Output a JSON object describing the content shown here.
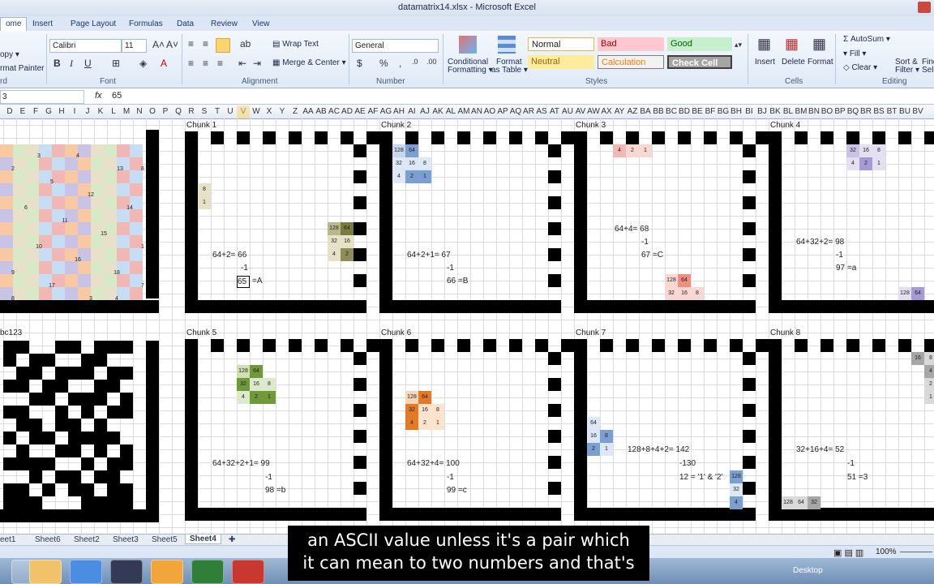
{
  "window": {
    "title": "datamatrix14.xlsx  -  Microsoft Excel"
  },
  "ribbon_tabs": [
    "ome",
    "Insert",
    "Page Layout",
    "Formulas",
    "Data",
    "Review",
    "View"
  ],
  "clipboard": {
    "copy": "opy ▾",
    "format_painter": "rmat Painter",
    "label": "rd"
  },
  "font": {
    "name": "Calibri",
    "size": "11",
    "label": "Font"
  },
  "alignment": {
    "wrap": "Wrap Text",
    "merge": "Merge & Center ▾",
    "label": "Alignment"
  },
  "number": {
    "format": "General",
    "label": "Number"
  },
  "styles": {
    "cond": "Conditional",
    "cond2": "Formatting ▾",
    "fmt": "Format",
    "fmt2": "as Table ▾",
    "normal": "Normal",
    "bad": "Bad",
    "good": "Good",
    "neutral": "Neutral",
    "calculation": "Calculation",
    "check": "Check Cell",
    "label": "Styles"
  },
  "cells_grp": {
    "insert": "Insert",
    "delete": "Delete",
    "format": "Format",
    "label": "Cells"
  },
  "editing": {
    "autosum": "AutoSum ▾",
    "fill": "Fill ▾",
    "clear": "Clear ▾",
    "sort": "Sort &",
    "filter": "Filter ▾",
    "find": "Find",
    "select": "Sele",
    "label": "Editing"
  },
  "formula_bar": {
    "name_box": "3",
    "fx": "fx",
    "value": "65"
  },
  "columns": [
    "D",
    "E",
    "F",
    "G",
    "H",
    "I",
    "J",
    "K",
    "L",
    "M",
    "N",
    "O",
    "P",
    "Q",
    "R",
    "S",
    "T",
    "U",
    "V",
    "W",
    "X",
    "Y",
    "Z",
    "AA",
    "AB",
    "AC",
    "AD",
    "AE",
    "AF",
    "AG",
    "AH",
    "AI",
    "AJ",
    "AK",
    "AL",
    "AM",
    "AN",
    "AO",
    "AP",
    "AQ",
    "AR",
    "AS",
    "AT",
    "AU",
    "AV",
    "AW",
    "AX",
    "AY",
    "AZ",
    "BA",
    "BB",
    "BC",
    "BD",
    "BE",
    "BF",
    "BG",
    "BH",
    "BI",
    "BJ",
    "BK",
    "BL",
    "BM",
    "BN",
    "BO",
    "BP",
    "BQ",
    "BR",
    "BS",
    "BT",
    "BU",
    "BV"
  ],
  "chunks": {
    "c1": "Chunk 1",
    "c2": "Chunk 2",
    "c3": "Chunk 3",
    "c4": "Chunk 4",
    "c5": "Chunk 5",
    "c6": "Chunk 6",
    "c7": "Chunk 7",
    "c8": "Chunk 8",
    "abc": "bc123"
  },
  "calcs": {
    "c1a": "64+2=  66",
    "c1b": "-1",
    "c1c": "65",
    "c1d": "=A",
    "c2a": "64+2+1=   67",
    "c2b": "-1",
    "c2c": "66  =B",
    "c3a": "64+4=  68",
    "c3b": "-1",
    "c3c": "67  =C",
    "c4a": "64+32+2=  98",
    "c4b": "-1",
    "c4c": "97  =a",
    "c5a": "64+32+2+1=   99",
    "c5b": "-1",
    "c5c": "98  =b",
    "c6a": "64+32+4=  100",
    "c6b": "-1",
    "c6c": "99  =c",
    "c7a": "128+8+4+2=   142",
    "c7b": "-130",
    "c7c": "12 = '1' & '2'",
    "c8a": "32+16+4=    52",
    "c8b": "-1",
    "c8c": "51  =3"
  },
  "sheets": [
    "eet1",
    "Sheet6",
    "Sheet2",
    "Sheet3",
    "Sheet5",
    "Sheet4"
  ],
  "status": {
    "zoom": "100%",
    "desktop": "Desktop"
  },
  "subtitle": {
    "line1": "an ASCII value unless it's a pair which",
    "line2": "it can mean to two numbers and that's"
  }
}
